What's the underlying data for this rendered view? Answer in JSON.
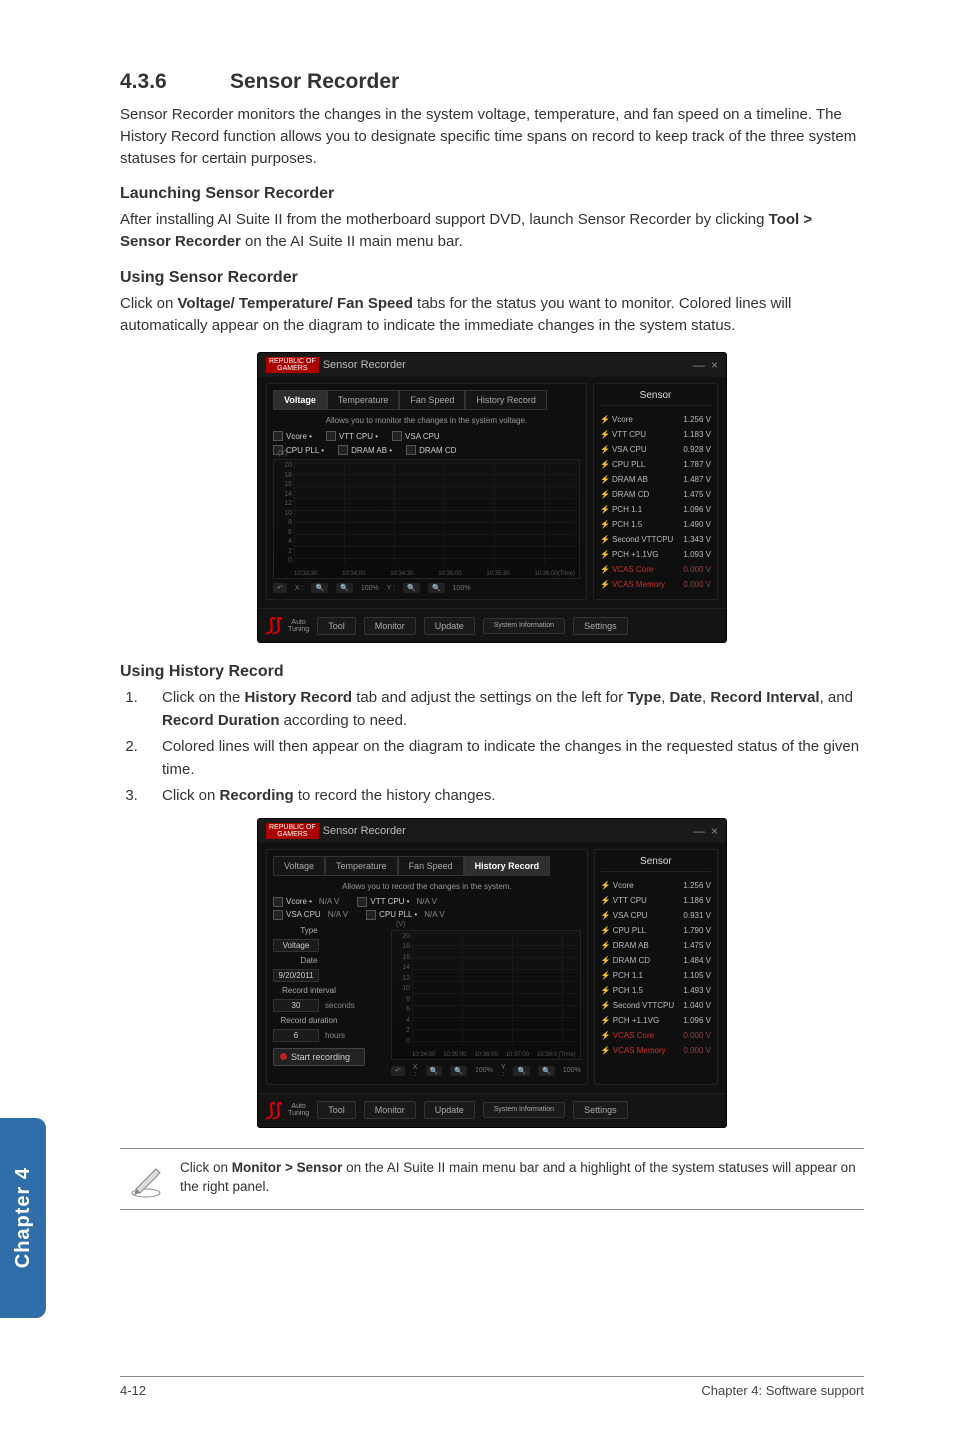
{
  "section": {
    "number": "4.3.6",
    "title": "Sensor Recorder"
  },
  "intro": "Sensor Recorder monitors the changes in the system voltage, temperature, and fan speed on a timeline. The History Record function allows you to designate specific time spans on record to keep track of the three system statuses for certain purposes.",
  "launch": {
    "heading": "Launching Sensor Recorder",
    "body_a": "After installing AI Suite II from the motherboard support DVD, launch Sensor Recorder by clicking ",
    "body_bold": "Tool > Sensor Recorder",
    "body_b": " on the AI Suite II main menu bar."
  },
  "using": {
    "heading": "Using Sensor Recorder",
    "body_a": "Click on ",
    "body_bold": "Voltage/ Temperature/ Fan Speed",
    "body_b": " tabs for the status you want to monitor. Colored lines will automatically appear on the diagram to indicate the immediate changes in the system status."
  },
  "history": {
    "heading": "Using History Record",
    "steps": [
      {
        "pre": "Click on the ",
        "b1": "History Record",
        "mid": " tab and adjust the settings on the left for ",
        "b2": "Type",
        "mid2": ", ",
        "b3": "Date",
        "mid3": ", ",
        "b4": "Record Interval",
        "mid4": ", and ",
        "b5": "Record Duration",
        "post": " according to need."
      },
      {
        "plain": "Colored lines will then appear on the diagram to indicate the changes in the requested status of the given time."
      },
      {
        "pre": "Click on ",
        "b1": "Recording",
        "post": " to record the history changes."
      }
    ]
  },
  "note": {
    "pre": "Click on ",
    "bold": "Monitor > Sensor",
    "post": " on the AI Suite II main menu bar and a highlight of the system statuses will appear on the right panel."
  },
  "chapter_tab": "Chapter 4",
  "footer": {
    "left": "4-12",
    "right": "Chapter 4: Software support"
  },
  "shot_common": {
    "brand_top": "REPUBLIC OF",
    "brand_bot": "GAMERS",
    "title": "Sensor Recorder",
    "min": "—",
    "close": "×",
    "tabs": [
      "Voltage",
      "Temperature",
      "Fan Speed",
      "History Record"
    ],
    "side_title": "Sensor",
    "bottom": {
      "auto1": "Auto",
      "auto2": "Tuning",
      "btns": [
        "Tool",
        "Monitor",
        "Update",
        "System Information",
        "Settings"
      ]
    }
  },
  "shot1": {
    "active_tab": 0,
    "hint": "Allows you to monitor the changes in the system voltage.",
    "checks_row1": [
      "Vcore •",
      "VTT CPU •",
      "VSA CPU"
    ],
    "checks_row2": [
      "CPU PLL •",
      "DRAM AB •",
      "DRAM CD"
    ],
    "unit": "(V)",
    "chart_data": {
      "type": "line",
      "y_ticks": [
        "20",
        "18",
        "16",
        "14",
        "12",
        "10",
        "8",
        "6",
        "4",
        "2",
        "0"
      ],
      "x_ticks": [
        "10:33:30",
        "10:34:00",
        "10:34:30",
        "10:35:00",
        "10:35:30",
        "10:36:00"
      ],
      "x_label_suffix": "(Time)",
      "zoom": {
        "undo": "↶",
        "x_label": "X :",
        "x_val": "100%",
        "y_label": "Y :",
        "y_val": "100%"
      }
    },
    "sensors": [
      {
        "name": "Vcore",
        "val": "1.256 V"
      },
      {
        "name": "VTT CPU",
        "val": "1.183 V"
      },
      {
        "name": "VSA CPU",
        "val": "0.928 V"
      },
      {
        "name": "CPU PLL",
        "val": "1.787 V"
      },
      {
        "name": "DRAM AB",
        "val": "1.487 V"
      },
      {
        "name": "DRAM CD",
        "val": "1.475 V"
      },
      {
        "name": "PCH 1.1",
        "val": "1.096 V"
      },
      {
        "name": "PCH 1.5",
        "val": "1.490 V"
      },
      {
        "name": "Second VTTCPU",
        "val": "1.343 V"
      },
      {
        "name": "PCH +1.1VG",
        "val": "1.093 V"
      },
      {
        "name": "VCAS Core",
        "val": "0.000 V",
        "red": true
      },
      {
        "name": "VCAS Memory",
        "val": "0.000 V",
        "red": true
      }
    ]
  },
  "shot2": {
    "active_tab": 3,
    "hint": "Allows you to record the changes in the system.",
    "checks_row1": [
      {
        "l": "Vcore •",
        "v": "N/A V"
      },
      {
        "l": "VTT CPU •",
        "v": "N/A V"
      }
    ],
    "checks_row2": [
      {
        "l": "VSA CPU",
        "v": "N/A V"
      },
      {
        "l": "CPU PLL •",
        "v": "N/A V"
      }
    ],
    "fields": {
      "type": {
        "label": "Type",
        "value": "Voltage"
      },
      "date": {
        "label": "Date",
        "value": "9/20/2011"
      },
      "interval": {
        "label": "Record interval",
        "value": "30",
        "unit": "seconds"
      },
      "duration": {
        "label": "Record duration",
        "value": "6",
        "unit": "hours"
      },
      "start": "Start recording"
    },
    "unit": "(V)",
    "chart_data": {
      "type": "line",
      "y_ticks": [
        "20",
        "18",
        "16",
        "14",
        "12",
        "10",
        "8",
        "6",
        "4",
        "2",
        "0"
      ],
      "x_ticks": [
        "10:34:00",
        "10:35:00",
        "10:36:00",
        "10:37:00",
        "10:38:0"
      ],
      "x_label_suffix": "(Time)",
      "zoom": {
        "undo": "↶",
        "x_label": "X :",
        "x_val": "100%",
        "y_label": "Y :",
        "y_val": "100%"
      }
    },
    "sensors": [
      {
        "name": "Vcore",
        "val": "1.256 V"
      },
      {
        "name": "VTT CPU",
        "val": "1.186 V"
      },
      {
        "name": "VSA CPU",
        "val": "0.931 V"
      },
      {
        "name": "CPU PLL",
        "val": "1.790 V"
      },
      {
        "name": "DRAM AB",
        "val": "1.475 V"
      },
      {
        "name": "DRAM CD",
        "val": "1.484 V"
      },
      {
        "name": "PCH 1.1",
        "val": "1.105 V"
      },
      {
        "name": "PCH 1.5",
        "val": "1.493 V"
      },
      {
        "name": "Second VTTCPU",
        "val": "1.040 V"
      },
      {
        "name": "PCH +1.1VG",
        "val": "1.096 V"
      },
      {
        "name": "VCAS Core",
        "val": "0.000 V",
        "red": true
      },
      {
        "name": "VCAS Memory",
        "val": "0.000 V",
        "red": true
      }
    ]
  }
}
